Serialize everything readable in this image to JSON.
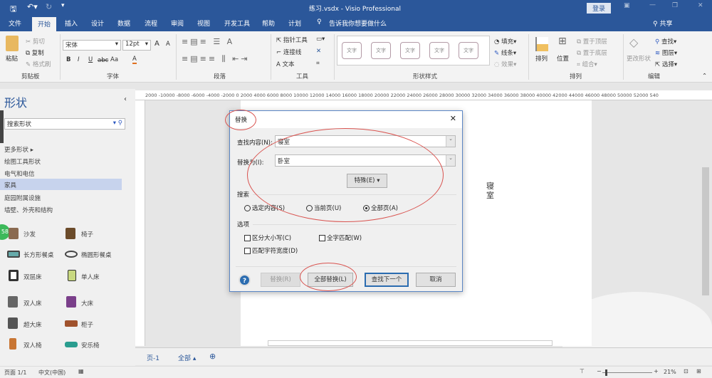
{
  "titlebar": {
    "doc_title": "练习.vsdx - Visio Professional",
    "login": "登录"
  },
  "tabs": [
    "文件",
    "开始",
    "插入",
    "设计",
    "数据",
    "流程",
    "审阅",
    "视图",
    "开发工具",
    "帮助",
    "计划"
  ],
  "tell_me": "告诉我你想要做什么",
  "share": "共享",
  "ribbon": {
    "clipboard": {
      "paste": "粘贴",
      "cut": "剪切",
      "copy": "复制",
      "format_painter": "格式刷",
      "label": "剪贴板"
    },
    "font": {
      "font_name": "宋体",
      "font_size": "12pt",
      "bold": "B",
      "italic": "I",
      "underline": "U",
      "strike": "abc",
      "case": "Aa",
      "color": "A",
      "grow": "A",
      "shrink": "A",
      "label": "字体"
    },
    "paragraph": {
      "label": "段落"
    },
    "tools": {
      "pointer": "指针工具",
      "connector": "连接线",
      "text": "文本",
      "label": "工具"
    },
    "shape_styles": {
      "sample": "文字",
      "fill": "填充",
      "line": "线条",
      "effects": "效果",
      "label": "形状样式"
    },
    "arrange": {
      "arrange": "排列",
      "position": "位置",
      "bring_front": "置于顶层",
      "send_back": "置于底层",
      "group": "组合",
      "label": "排列"
    },
    "editing": {
      "change_shape": "更改形状",
      "find": "查找",
      "layers": "图层",
      "select": "选择",
      "label": "编辑"
    }
  },
  "shapes_pane": {
    "title": "形状",
    "search_placeholder": "搜索形状",
    "more_shapes": "更多形状",
    "categories": [
      "绘图工具形状",
      "电气和电信",
      "家具",
      "庭园附属设施",
      "墙壁、外壳和结构"
    ],
    "badge": "58",
    "items": [
      "沙发",
      "椅子",
      "长方形餐桌",
      "椭圆形餐桌",
      "双层床",
      "单人床",
      "双人床",
      "大床",
      "超大床",
      "柜子",
      "双人椅",
      "安乐椅"
    ]
  },
  "ruler": "2000 -10000 -8000 -6000 -4000 -2000 0    2000 4000 6000 8000 10000 12000 14000 16000 18000 20000 22000 24000 26000 28000 30000 32000 34000 36000 38000 40000 42000 44000 46000 48000 50000 52000 540",
  "canvas": {
    "shape_text": "寝室"
  },
  "dialog": {
    "title": "替换",
    "find_label": "查找内容(N):",
    "find_value": "寝室",
    "replace_label": "替换为(I):",
    "replace_value": "卧室",
    "special": "特殊(E)",
    "search_label": "搜索",
    "search_options": [
      "选定内容(S)",
      "当前页(U)",
      "全部页(A)"
    ],
    "options_label": "选项",
    "checkbox_options": [
      "区分大小写(C)",
      "全字匹配(W)",
      "匹配字符宽度(D)"
    ],
    "help": "?",
    "replace_btn": "替换(R)",
    "replace_all_btn": "全部替换(L)",
    "find_next_btn": "查找下一个",
    "cancel_btn": "取消"
  },
  "page_tabs": {
    "page": "页-1",
    "all": "全部"
  },
  "status": {
    "page": "页面 1/1",
    "lang": "中文(中国)",
    "zoom": "21%"
  }
}
